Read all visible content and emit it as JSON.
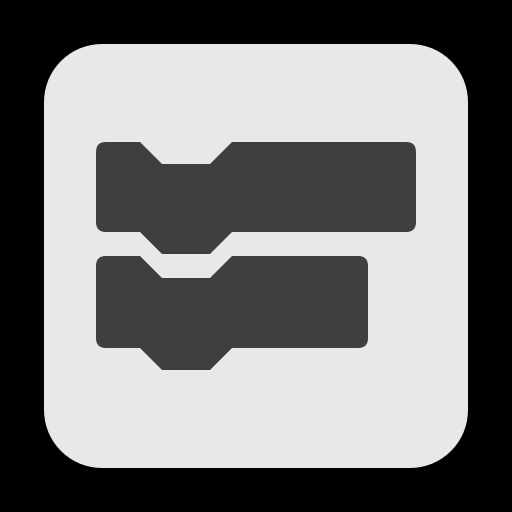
{
  "app_icon": {
    "name": "code-blocks-app-icon",
    "colors": {
      "background": "#000000",
      "tile": "#e8e8e8",
      "block": "#3f3f3f"
    },
    "blocks": [
      {
        "name": "top-code-block"
      },
      {
        "name": "bottom-code-block"
      }
    ]
  }
}
